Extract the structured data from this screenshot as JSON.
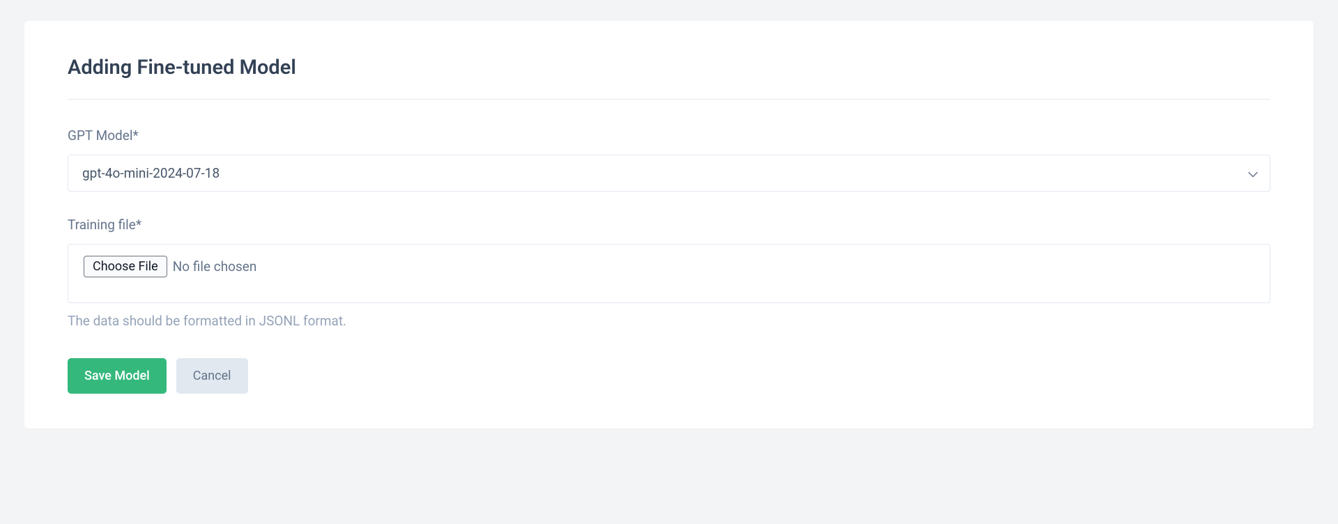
{
  "header": {
    "title": "Adding Fine-tuned Model"
  },
  "form": {
    "gpt_model": {
      "label": "GPT Model*",
      "value": "gpt-4o-mini-2024-07-18"
    },
    "training_file": {
      "label": "Training file*",
      "choose_button": "Choose File",
      "status": "No file chosen",
      "helper": "The data should be formatted in JSONL format."
    }
  },
  "actions": {
    "save": "Save Model",
    "cancel": "Cancel"
  }
}
